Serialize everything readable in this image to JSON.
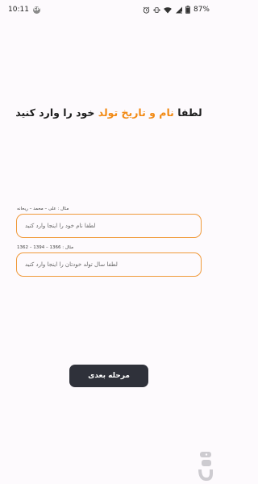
{
  "status_bar": {
    "time": "10:11",
    "notification_badge": "GP",
    "battery_percent": "87%"
  },
  "headline": {
    "part1": "لطفا ",
    "part2": "نام و تاریخ تولد",
    "part3": " خود را وارد کنید"
  },
  "name_field": {
    "hint": "مثال : علی – محمد – ریحانه",
    "placeholder": "لطفا نام خود را اینجا وارد کنید"
  },
  "year_field": {
    "hint": "مثال : 1366 – 1394 – 1362",
    "placeholder": "لطفا سال تولد خودتان را اینجا وارد کنید"
  },
  "next_button": {
    "label": "مرحله بعدی"
  },
  "colors": {
    "accent": "#f28a14",
    "field_border": "#f09a3a",
    "button_bg": "#2f313a",
    "background": "#fdfafd"
  },
  "icons": [
    "alarm-icon",
    "vibrate-icon",
    "wifi-icon",
    "signal-icon",
    "battery-icon"
  ]
}
